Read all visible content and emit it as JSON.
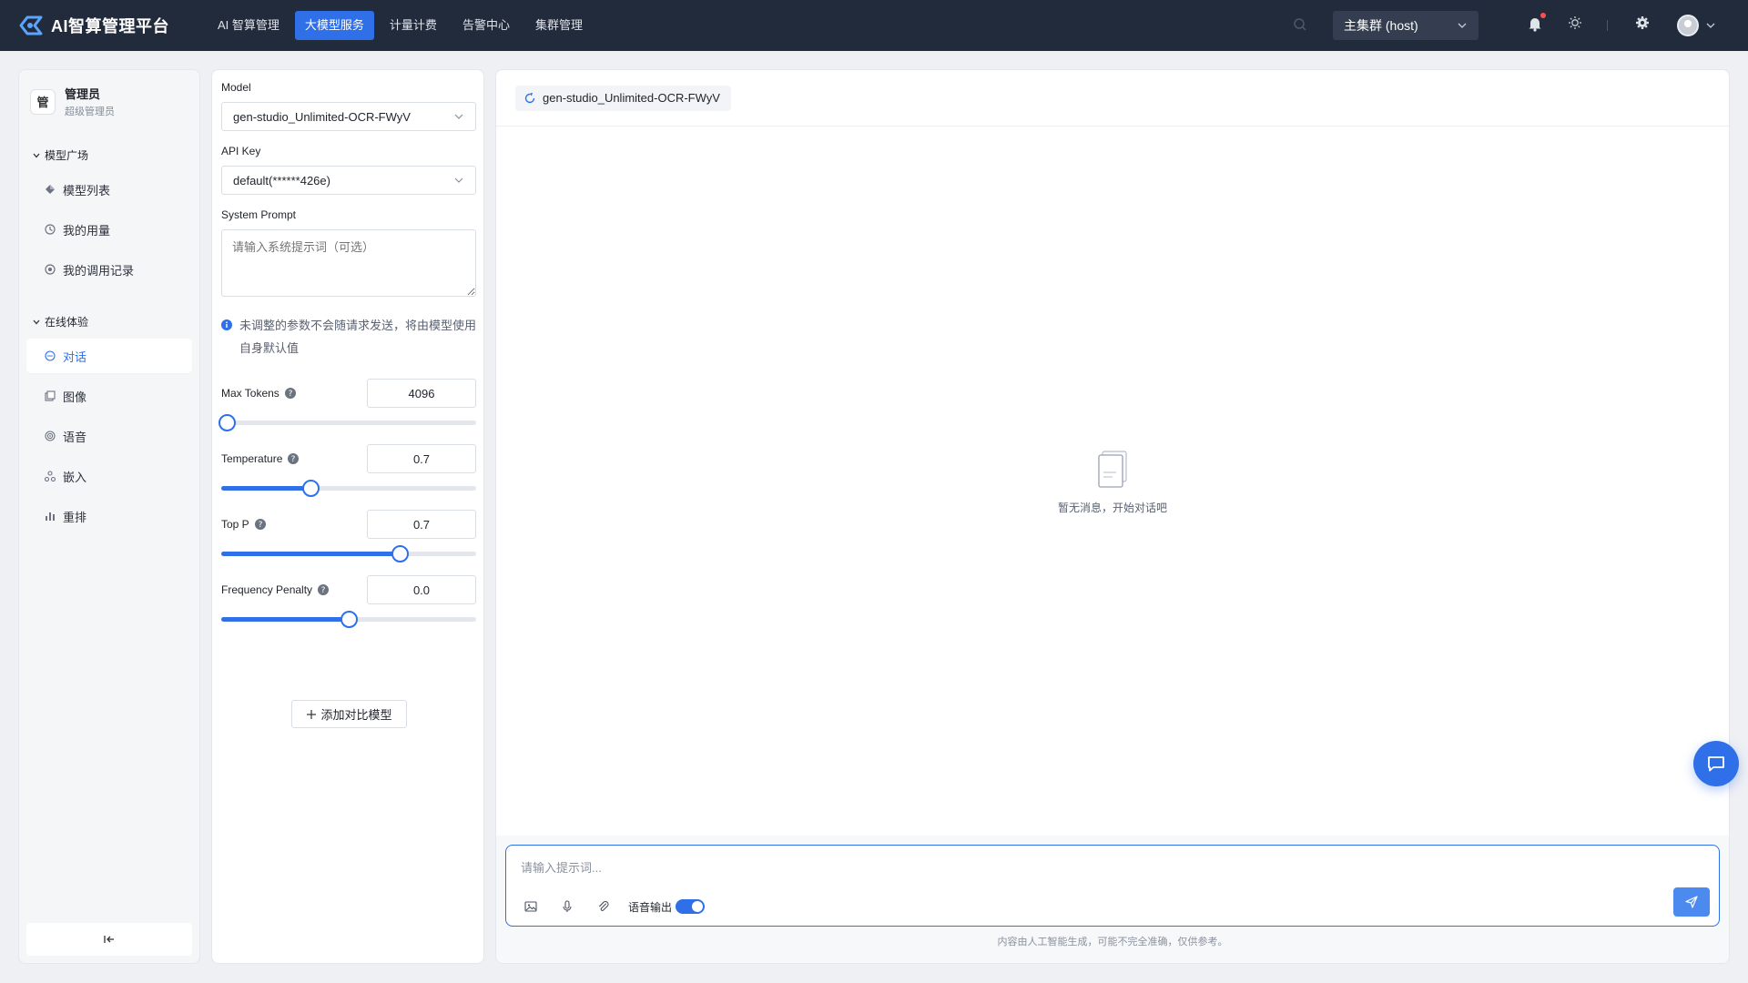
{
  "app": {
    "title": "AI智算管理平台"
  },
  "nav": {
    "items": [
      {
        "label": "AI 智算管理"
      },
      {
        "label": "大模型服务"
      },
      {
        "label": "计量计费"
      },
      {
        "label": "告警中心"
      },
      {
        "label": "集群管理"
      }
    ],
    "active_index": 1
  },
  "header": {
    "cluster": "主集群 (host)"
  },
  "user": {
    "badge": "管",
    "name": "管理员",
    "role": "超级管理员"
  },
  "sidebar": {
    "groups": [
      {
        "title": "模型广场",
        "items": [
          {
            "label": "模型列表",
            "icon": "diamond-icon"
          },
          {
            "label": "我的用量",
            "icon": "usage-icon"
          },
          {
            "label": "我的调用记录",
            "icon": "record-icon"
          }
        ]
      },
      {
        "title": "在线体验",
        "items": [
          {
            "label": "对话",
            "icon": "chat-icon"
          },
          {
            "label": "图像",
            "icon": "image-icon"
          },
          {
            "label": "语音",
            "icon": "audio-icon"
          },
          {
            "label": "嵌入",
            "icon": "embed-icon"
          },
          {
            "label": "重排",
            "icon": "rerank-icon"
          }
        ]
      }
    ],
    "active": "对话"
  },
  "params": {
    "model_label": "Model",
    "model_value": "gen-studio_Unlimited-OCR-FWyV",
    "apikey_label": "API Key",
    "apikey_value": "default(******426e)",
    "system_prompt_label": "System Prompt",
    "system_prompt_placeholder": "请输入系统提示词（可选）",
    "notice": "未调整的参数不会随请求发送，将由模型使用自身默认值",
    "sliders": [
      {
        "name": "Max Tokens",
        "value": "4096",
        "fraction": 0.02
      },
      {
        "name": "Temperature",
        "value": "0.7",
        "fraction": 0.35
      },
      {
        "name": "Top P",
        "value": "0.7",
        "fraction": 0.7
      },
      {
        "name": "Frequency Penalty",
        "value": "0.0",
        "fraction": 0.5
      }
    ],
    "add_compare": "添加对比模型"
  },
  "chat": {
    "model_chip": "gen-studio_Unlimited-OCR-FWyV",
    "empty_text": "暂无消息，开始对话吧",
    "input_placeholder": "请输入提示词...",
    "voice_output_label": "语音输出",
    "voice_output_on": true,
    "disclaimer": "内容由人工智能生成，可能不完全准确，仅供参考。"
  },
  "colors": {
    "primary": "#2f6fe8",
    "topbar": "#222b3b",
    "background": "#eef0f4"
  }
}
